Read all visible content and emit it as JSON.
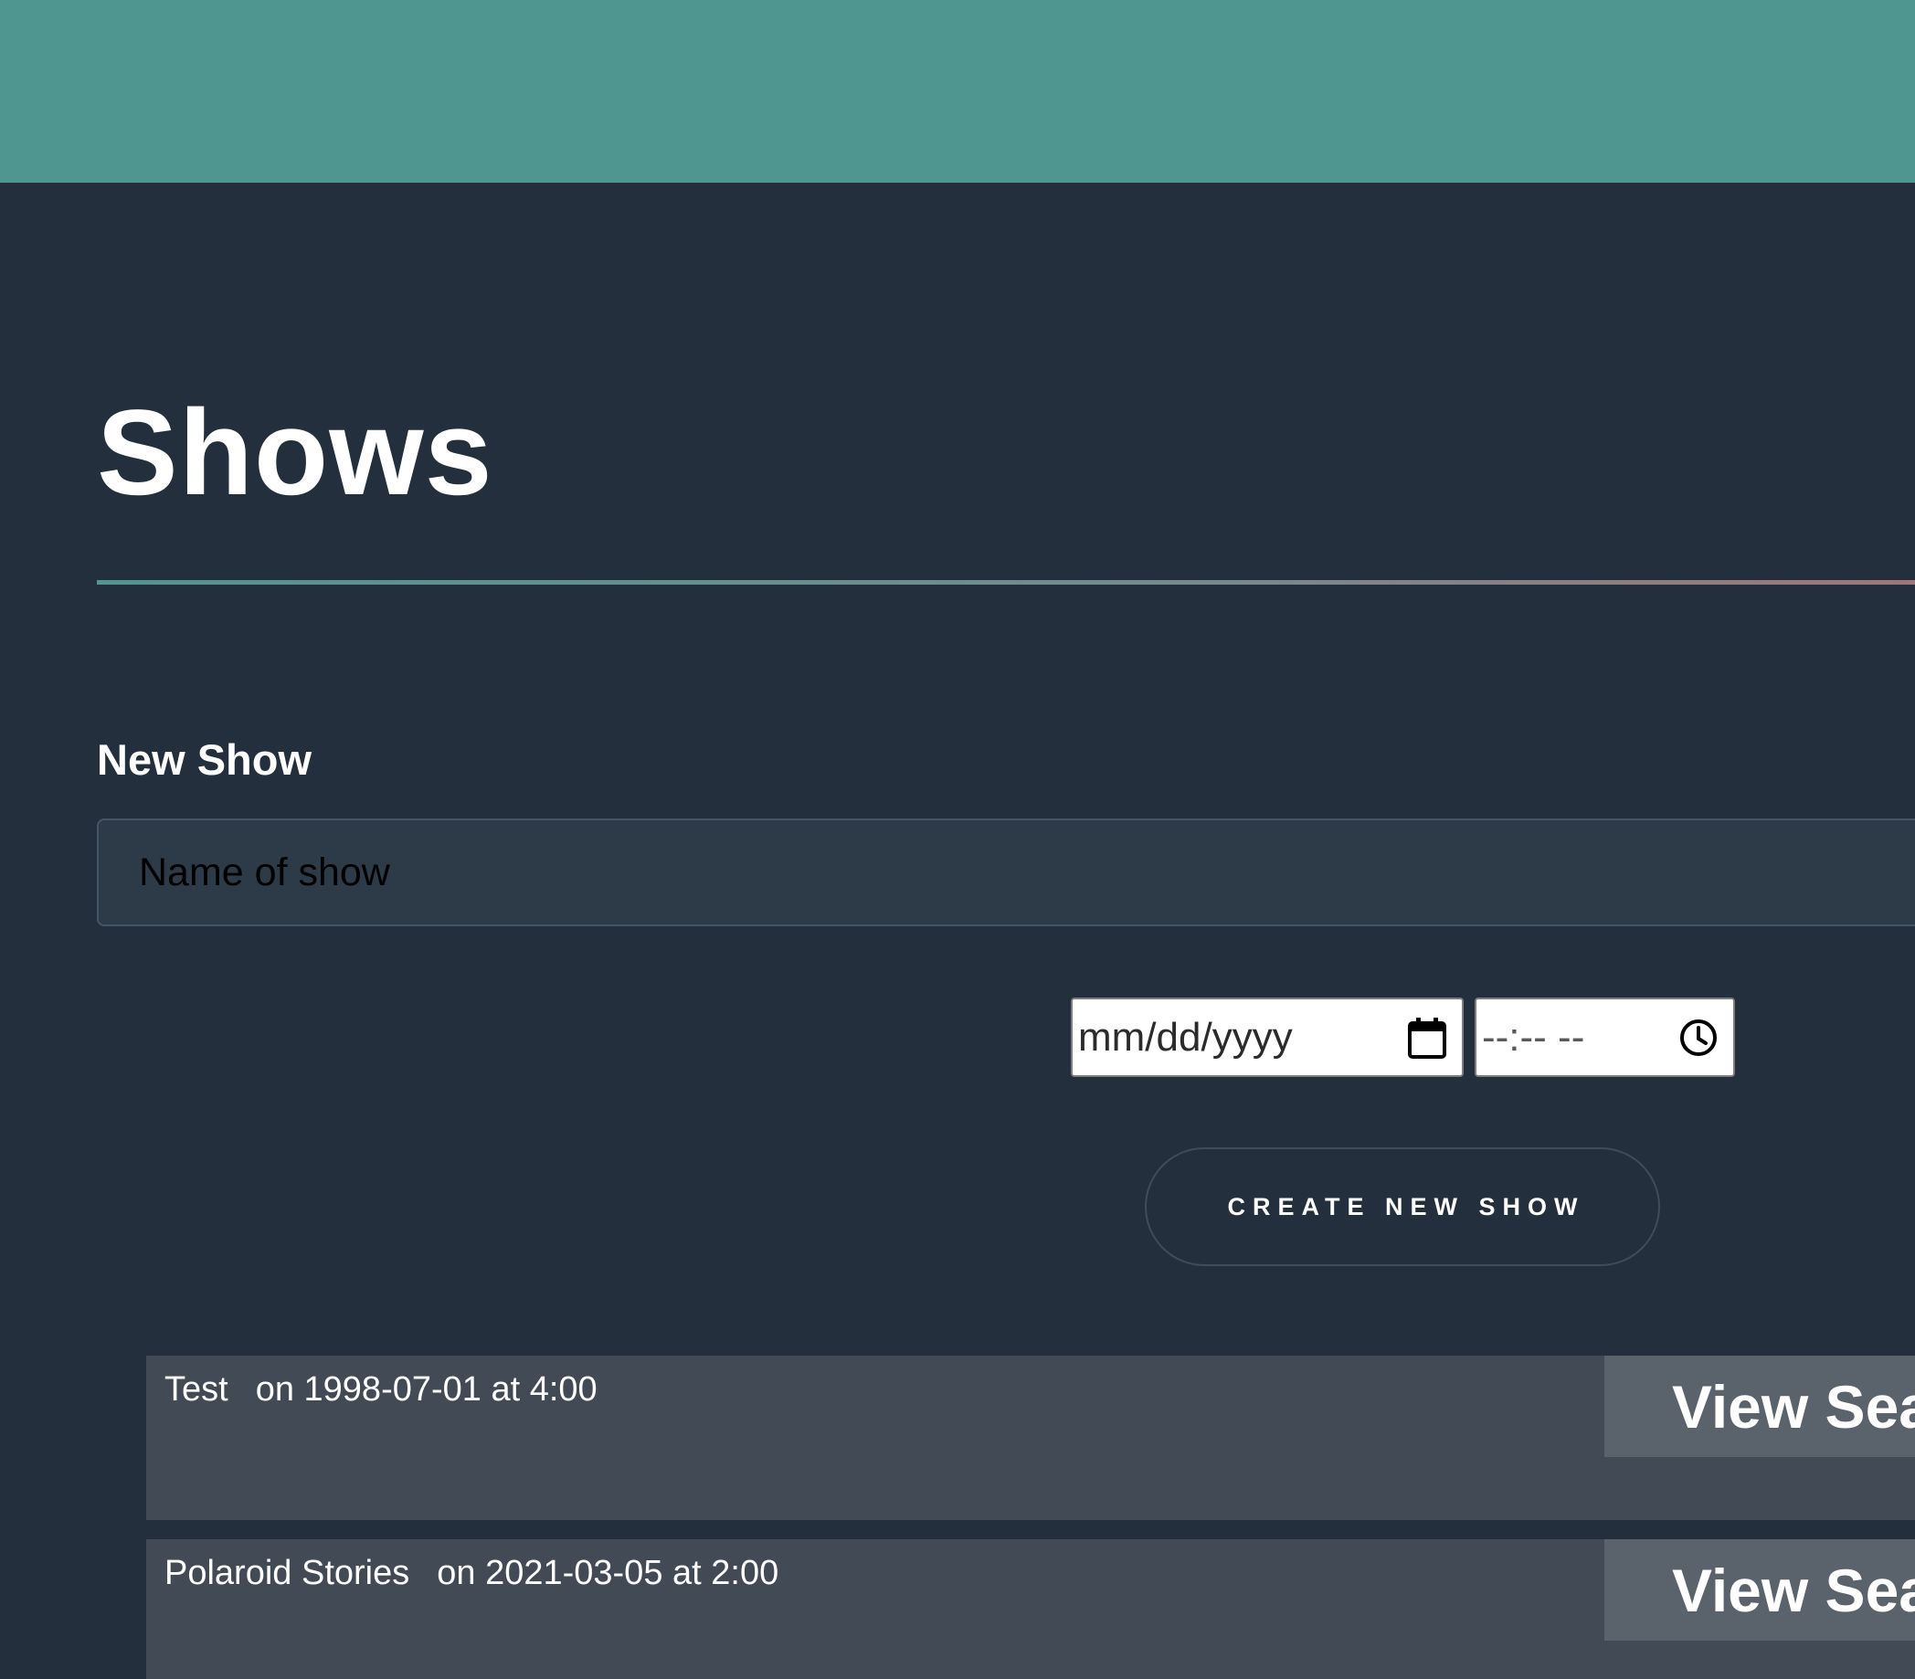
{
  "header": {
    "title": "Shows"
  },
  "new_show": {
    "heading": "New Show",
    "name_placeholder": "Name of show",
    "date_placeholder": "mm/dd/yyyy",
    "time_placeholder": "--:-- --",
    "create_label": "CREATE NEW SHOW"
  },
  "shows": [
    {
      "name": "Test",
      "when": "on 1998-07-01 at 4:00",
      "action_label": "View Seats"
    },
    {
      "name": "Polaroid Stories",
      "when": "on 2021-03-05 at 2:00",
      "action_label": "View Seats"
    }
  ],
  "icons": {
    "date": "calendar-icon",
    "time": "clock-icon"
  },
  "colors": {
    "topbar": "#4f9590",
    "background": "#232f3c",
    "row": "#424b55",
    "view_button": "#5a626c"
  }
}
